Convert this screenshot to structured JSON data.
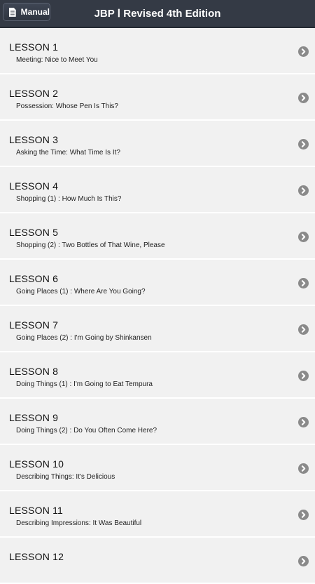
{
  "header": {
    "manual_label": "Manual",
    "title": "JBP Ⅰ  Revised 4th Edition"
  },
  "colors": {
    "header_bg": "#343a45",
    "list_bg": "#f1f1f1",
    "chevron": "#8a8a8a"
  },
  "icons": {
    "manual": "document-icon",
    "row": "chevron-right-circle-icon"
  },
  "lessons": [
    {
      "title": "LESSON 1",
      "subtitle": "Meeting: Nice to Meet You"
    },
    {
      "title": "LESSON 2",
      "subtitle": "Possession: Whose Pen Is This?"
    },
    {
      "title": "LESSON 3",
      "subtitle": "Asking the Time: What Time Is It?"
    },
    {
      "title": "LESSON 4",
      "subtitle": "Shopping (1) : How Much Is This?"
    },
    {
      "title": "LESSON 5",
      "subtitle": "Shopping (2) : Two Bottles of That Wine, Please"
    },
    {
      "title": "LESSON 6",
      "subtitle": "Going Places (1) : Where Are You Going?"
    },
    {
      "title": "LESSON 7",
      "subtitle": "Going Places (2) : I'm Going by Shinkansen"
    },
    {
      "title": "LESSON 8",
      "subtitle": "Doing Things (1) : I'm Going to Eat Tempura"
    },
    {
      "title": "LESSON 9",
      "subtitle": "Doing Things (2) : Do You Often Come Here?"
    },
    {
      "title": "LESSON 10",
      "subtitle": "Describing Things: It's Delicious"
    },
    {
      "title": "LESSON 11",
      "subtitle": "Describing Impressions: It Was Beautiful"
    },
    {
      "title": "LESSON 12",
      "subtitle": ""
    }
  ]
}
